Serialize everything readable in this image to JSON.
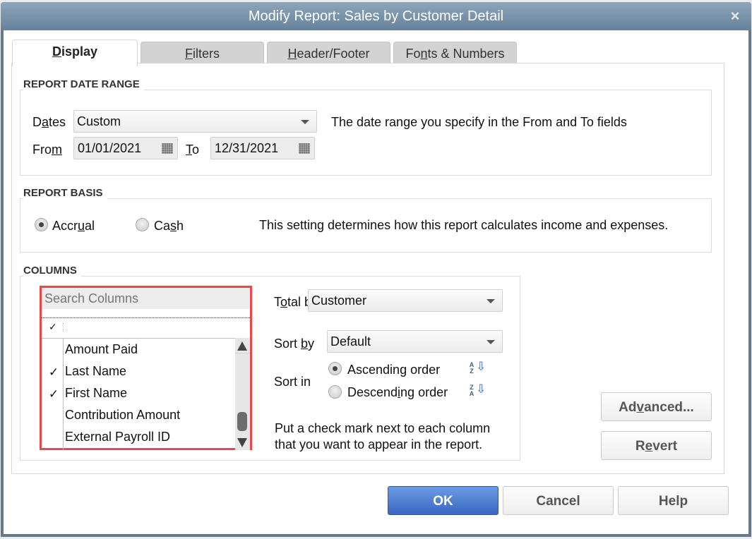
{
  "window": {
    "title": "Modify Report: Sales by Customer Detail",
    "close_icon": "×"
  },
  "tabs": [
    {
      "label": "Display",
      "mnemonic_index": 0,
      "active": true
    },
    {
      "label": "Filters",
      "mnemonic_index": 0,
      "active": false
    },
    {
      "label": "Header/Footer",
      "mnemonic_index": 0,
      "active": false
    },
    {
      "label": "Fonts & Numbers",
      "mnemonic_index": 2,
      "active": false
    }
  ],
  "date_range": {
    "heading": "REPORT DATE RANGE",
    "dates_label_pre": "D",
    "dates_label_u": "a",
    "dates_label_post": "tes",
    "dates_value": "Custom",
    "description": "The date range you specify in the From and To fields",
    "from_label_pre": "Fro",
    "from_label_u": "m",
    "from_value": "01/01/2021",
    "to_label_u": "T",
    "to_label_post": "o",
    "to_value": "12/31/2021",
    "calendar_icon": "calendar-icon"
  },
  "report_basis": {
    "heading": "REPORT BASIS",
    "accrual_pre": "Accr",
    "accrual_u": "u",
    "accrual_post": "al",
    "cash_pre": "Ca",
    "cash_u": "s",
    "cash_post": "h",
    "selected": "Accrual",
    "description": "This setting determines how this report calculates income and expenses."
  },
  "columns": {
    "heading": "COLUMNS",
    "search_placeholder": "Search Columns",
    "header_check": "✓",
    "items": [
      {
        "label": "Amount Paid",
        "checked": false,
        "check": ""
      },
      {
        "label": "Last Name",
        "checked": true,
        "check": "✓"
      },
      {
        "label": "First Name",
        "checked": true,
        "check": "✓"
      },
      {
        "label": "Contribution Amount",
        "checked": false,
        "check": ""
      },
      {
        "label": "External Payroll ID",
        "checked": false,
        "check": ""
      }
    ],
    "total_by_pre": "T",
    "total_by_u": "o",
    "total_by_post": "tal by",
    "total_by_value": "Customer",
    "sort_by_pre": "Sort ",
    "sort_by_u": "b",
    "sort_by_post": "y",
    "sort_by_value": "Default",
    "sort_in_label": "Sort in",
    "ascending_pre": "Ascendin",
    "ascending_u": "g",
    "ascending_post": " order",
    "descending_pre": "Descend",
    "descending_u": "i",
    "descending_post": "ng order",
    "sort_selected": "Ascending order",
    "ascending_icon_letters": "A Z",
    "descending_icon_letters": "Z A",
    "sort_arrow": "⇩",
    "help_line1": "Put a check mark next to each column",
    "help_line2": "that you want to appear in the report."
  },
  "buttons": {
    "advanced_pre": "Ad",
    "advanced_u": "v",
    "advanced_post": "anced...",
    "revert_pre": "R",
    "revert_u": "e",
    "revert_post": "vert",
    "ok": "OK",
    "cancel": "Cancel",
    "help": "Help"
  },
  "colors": {
    "titlebar": "#7891a8",
    "highlight_border": "#e8474b",
    "ok_button": "#4a7bd0"
  }
}
